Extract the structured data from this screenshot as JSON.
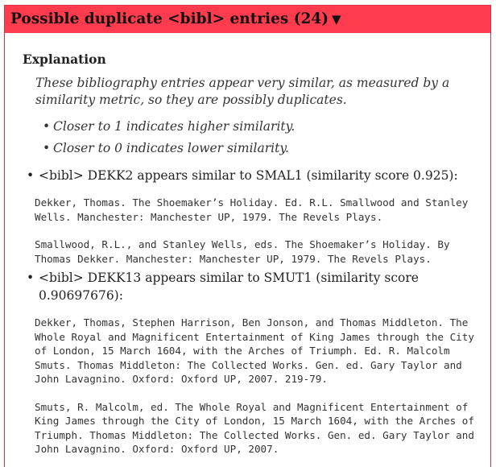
{
  "panel": {
    "title": "Possible duplicate <bibl> entries (24)",
    "toggle_icon": "▼"
  },
  "explanation": {
    "heading": "Explanation",
    "text": "These bibliography entries appear very similar, as measured by a similarity metric, so they are possibly duplicates.",
    "bullets": [
      "Closer to 1 indicates higher similarity.",
      "Closer to 0 indicates lower similarity."
    ]
  },
  "pairs": [
    {
      "title": "<bibl> DEKK2 appears similar to SMAL1 (similarity score 0.925):",
      "entry_a": "Dekker, Thomas. The Shoemaker’s Holiday. Ed. R.L. Smallwood and Stanley Wells. Manchester: Manchester UP, 1979. The Revels Plays.",
      "entry_b": "Smallwood, R.L., and Stanley Wells, eds. The Shoemaker’s Holiday. By Thomas Dekker. Manchester: Manchester UP, 1979. The Revels Plays."
    },
    {
      "title": "<bibl> DEKK13 appears similar to SMUT1 (similarity score 0.90697676):",
      "entry_a": "Dekker, Thomas, Stephen Harrison, Ben Jonson, and Thomas Middleton. The Whole Royal and Magnificent Entertainment of King James through the City of London, 15 March 1604, with the Arches of Triumph. Ed. R. Malcolm Smuts. Thomas Middleton: The Collected Works. Gen. ed. Gary Taylor and John Lavagnino. Oxford: Oxford UP, 2007. 219-79.",
      "entry_b": "Smuts, R. Malcolm, ed. The Whole Royal and Magnificent Entertainment of King James through the City of London, 15 March 1604, with the Arches of Triumph. Thomas Middleton: The Collected Works. Gen. ed. Gary Taylor and John Lavagnino. Oxford: Oxford UP, 2007."
    }
  ]
}
